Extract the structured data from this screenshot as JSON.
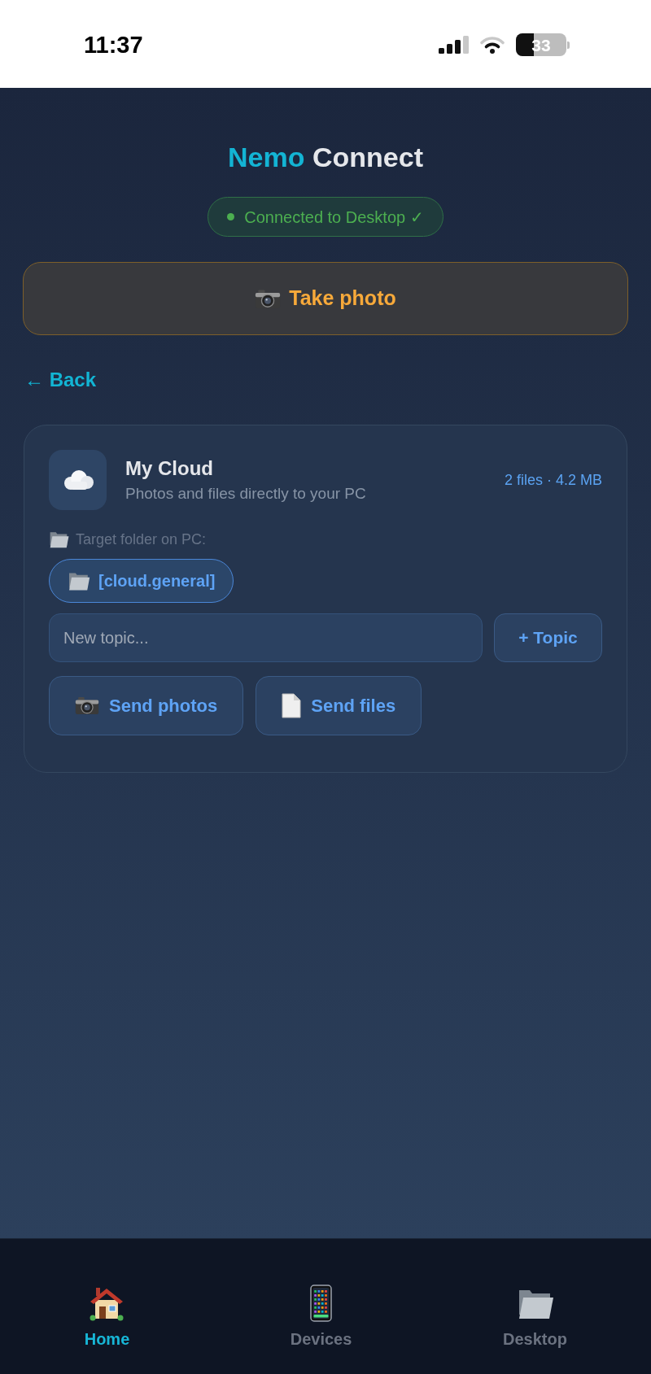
{
  "status_bar": {
    "time": "11:37",
    "battery": "33"
  },
  "header": {
    "title": {
      "highlight": "Nemo",
      "rest": "Connect"
    },
    "connection": {
      "text": "Connected to Desktop ✓",
      "connected": true
    }
  },
  "take_photo_button": {
    "label": "Take photo"
  },
  "back_link": {
    "label": "← Back"
  },
  "card": {
    "title": "My Cloud",
    "subtitle": "Photos and files directly to your PC",
    "stats": "2 files · 4.2 MB",
    "target_label": "Target folder on PC:",
    "folders": [
      {
        "label": "[cloud.general]",
        "selected": true
      }
    ],
    "topic_input": {
      "placeholder": "New topic..."
    },
    "add_topic_button": "+ Topic",
    "actions": [
      {
        "label": "Send photos"
      },
      {
        "label": "Send files"
      }
    ]
  },
  "bottom_nav": [
    {
      "label": "Home",
      "selected": true
    },
    {
      "label": "Devices",
      "selected": false
    },
    {
      "label": "Desktop",
      "selected": false
    }
  ]
}
